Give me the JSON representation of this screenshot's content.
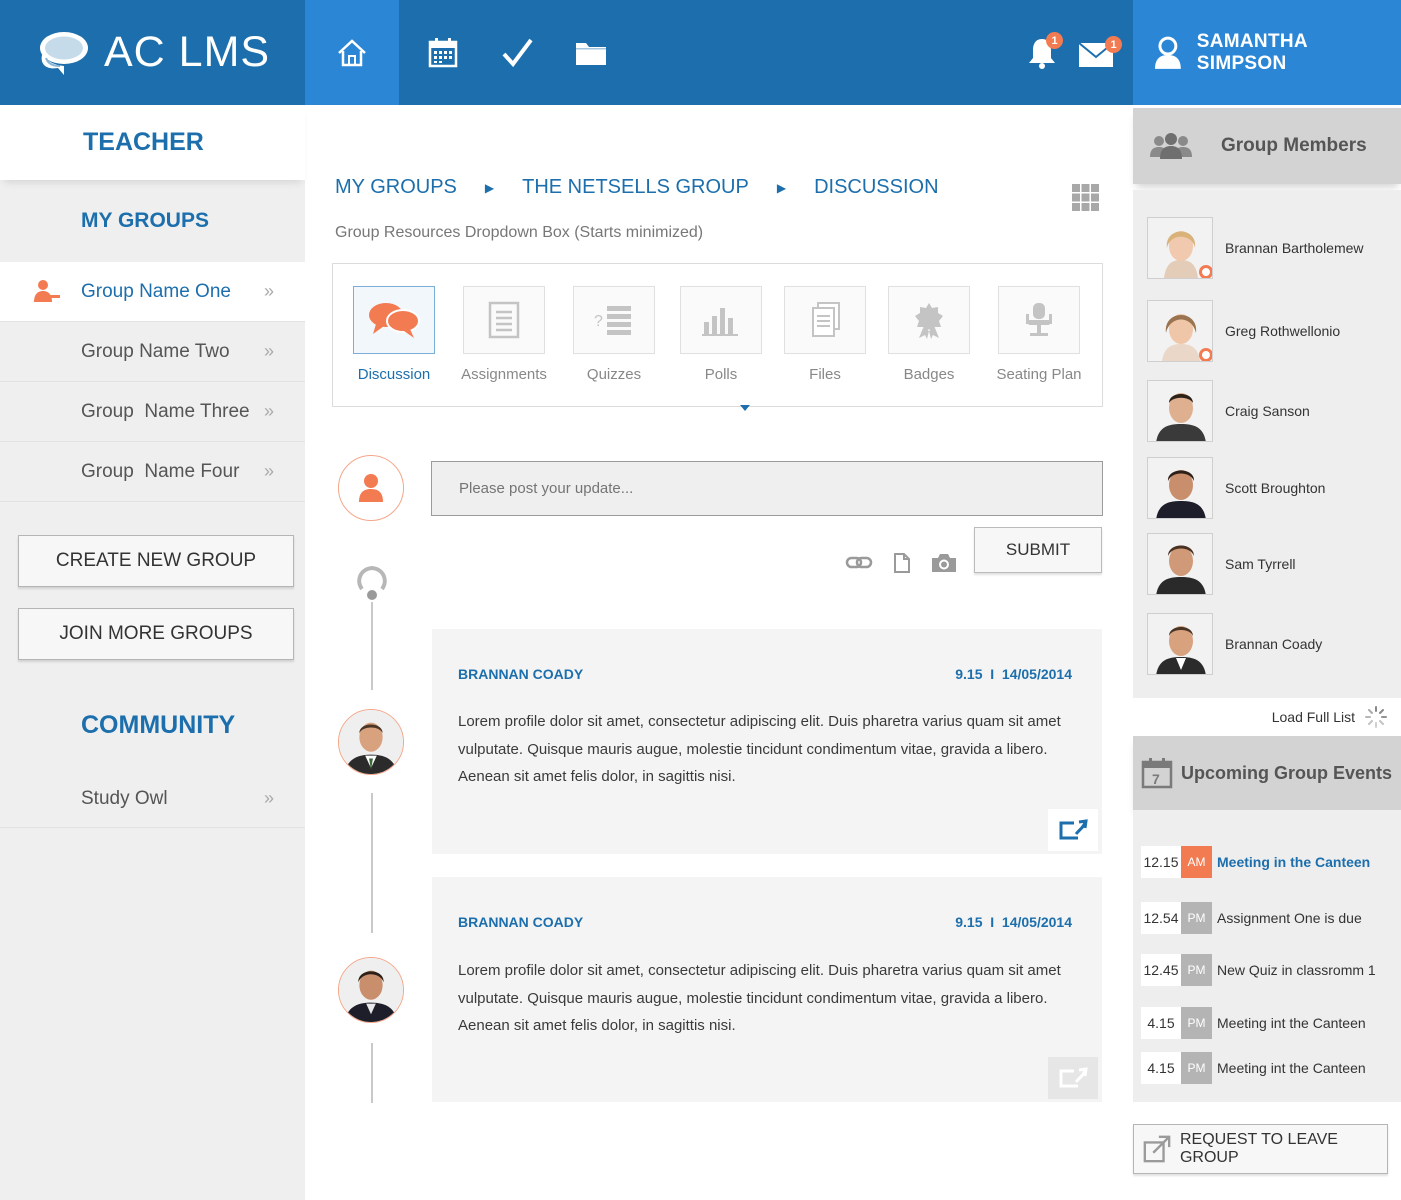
{
  "app": {
    "logo_text": "AC LMS",
    "accent": "#1c6fac",
    "accent_light": "#2b87d6",
    "orange": "#f37b52"
  },
  "topnav": {
    "items": [
      {
        "icon": "home-icon",
        "active": true
      },
      {
        "icon": "calendar-icon",
        "active": false
      },
      {
        "icon": "checkmark-icon",
        "active": false
      },
      {
        "icon": "folder-icon",
        "active": false
      }
    ],
    "notifications_count": "1",
    "messages_count": "1",
    "user_name": "SAMANTHA SIMPSON"
  },
  "sidebar": {
    "role_title": "TEACHER",
    "groups_title": "MY GROUPS",
    "groups": [
      {
        "label": "Group Name One",
        "active": true
      },
      {
        "label": "Group Name Two",
        "active": false
      },
      {
        "label": "Group  Name Three",
        "active": false
      },
      {
        "label": "Group  Name Four",
        "active": false
      }
    ],
    "create_button": "CREATE NEW GROUP",
    "join_button": "JOIN MORE GROUPS",
    "community_title": "COMMUNITY",
    "community_items": [
      {
        "label": "Study Owl"
      }
    ]
  },
  "main": {
    "breadcrumb": [
      "MY GROUPS",
      "THE NETSELLS GROUP",
      "DISCUSSION"
    ],
    "subtitle": "Group Resources Dropdown Box (Starts minimized)",
    "resources": [
      {
        "label": "Discussion",
        "icon": "discussion-icon",
        "active": true
      },
      {
        "label": "Assignments",
        "icon": "assignments-icon",
        "active": false
      },
      {
        "label": "Quizzes",
        "icon": "quizzes-icon",
        "active": false
      },
      {
        "label": "Polls",
        "icon": "polls-icon",
        "active": false
      },
      {
        "label": "Files",
        "icon": "files-icon",
        "active": false
      },
      {
        "label": "Badges",
        "icon": "badges-icon",
        "active": false
      },
      {
        "label": "Seating Plan",
        "icon": "seating-plan-icon",
        "active": false
      }
    ],
    "post_placeholder": "Please post your update...",
    "submit_label": "SUBMIT",
    "posts": [
      {
        "author": "BRANNAN COADY",
        "datetime": "9.15  I  14/05/2014",
        "lines": [
          "Lorem profile dolor sit amet, consectetur adipiscing elit. Duis pharetra varius quam sit amet",
          "vulputate. Quisque mauris augue, molestie tincidunt condimentum vitae, gravida a libero.",
          "Aenean sit amet felis dolor, in sagittis nisi."
        ]
      },
      {
        "author": "BRANNAN COADY",
        "datetime": "9.15  I  14/05/2014",
        "lines": [
          "Lorem profile dolor sit amet, consectetur adipiscing elit. Duis pharetra varius quam sit amet",
          "vulputate. Quisque mauris augue, molestie tincidunt condimentum vitae, gravida a libero.",
          "Aenean sit amet felis dolor, in sagittis nisi."
        ]
      }
    ]
  },
  "right": {
    "members_title": "Group Members",
    "members": [
      {
        "name": "Brannan Bartholemew",
        "online": true
      },
      {
        "name": "Greg Rothwellonio",
        "online": true
      },
      {
        "name": "Craig Sanson",
        "online": false
      },
      {
        "name": "Scott Broughton",
        "online": false
      },
      {
        "name": "Sam Tyrrell",
        "online": false
      },
      {
        "name": "Brannan Coady",
        "online": false
      }
    ],
    "load_full": "Load Full List",
    "events_title": "Upcoming Group Events",
    "events": [
      {
        "time": "12.15",
        "ampm": "AM",
        "title": "Meeting in the Canteen",
        "highlight": true
      },
      {
        "time": "12.54",
        "ampm": "PM",
        "title": "Assignment One is due",
        "highlight": false
      },
      {
        "time": "12.45",
        "ampm": "PM",
        "title": "New Quiz in classromm 1",
        "highlight": false
      },
      {
        "time": "4.15",
        "ampm": "PM",
        "title": "Meeting int the Canteen",
        "highlight": false
      },
      {
        "time": "4.15",
        "ampm": "PM",
        "title": "Meeting int the Canteen",
        "highlight": false
      }
    ],
    "leave_button": "REQUEST TO LEAVE GROUP"
  }
}
